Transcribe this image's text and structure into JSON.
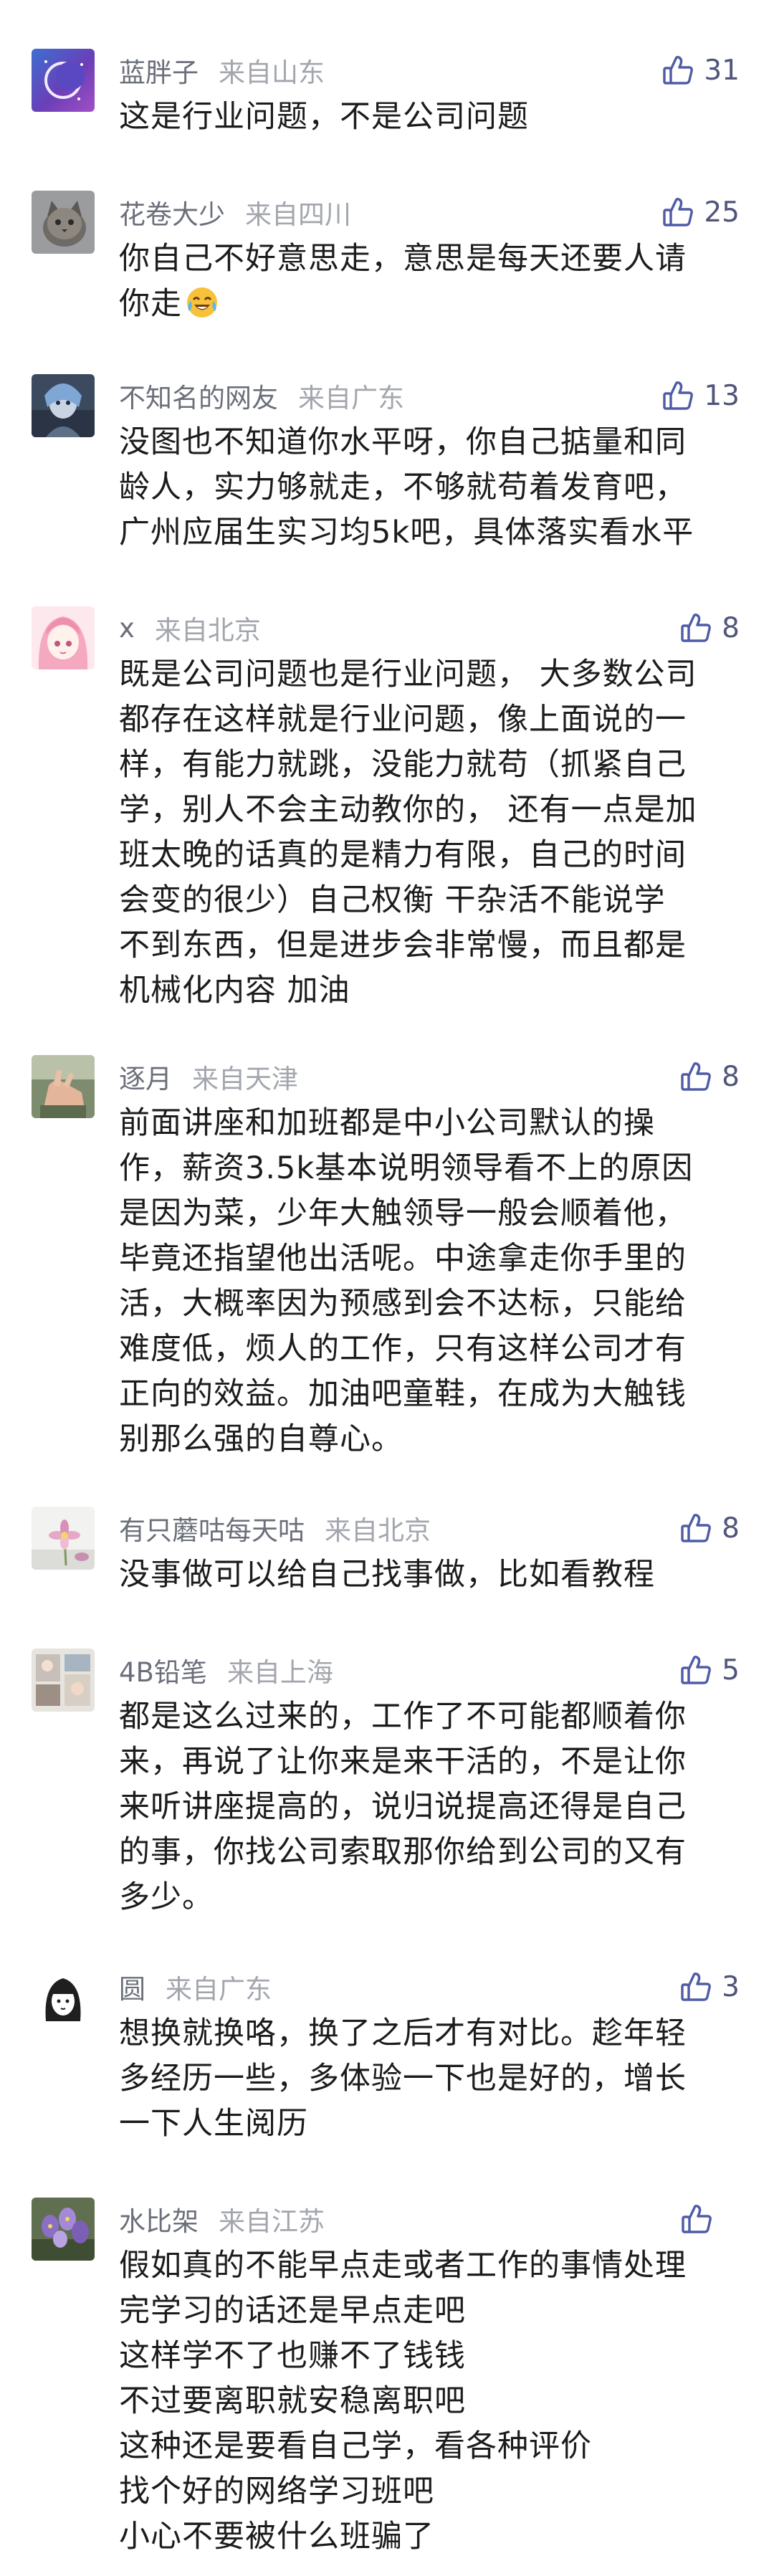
{
  "colors": {
    "username": "#6b6f7a",
    "location": "#a3a6ad",
    "like_icon": "#4e5ba6",
    "text": "#1c1c1e"
  },
  "comments": [
    {
      "username": "蓝胖子",
      "location": "来自山东",
      "likes": "31",
      "avatar_icon": "night-moon-avatar",
      "lines": [
        "这是行业问题，不是公司问题"
      ]
    },
    {
      "username": "花卷大少",
      "location": "来自四川",
      "likes": "25",
      "avatar_icon": "cat-avatar",
      "lines": [
        "你自己不好意思走，意思是每天还要人请",
        "你走"
      ],
      "emoji": "laughing-crying-emoji"
    },
    {
      "username": "不知名的网友",
      "location": "来自广东",
      "likes": "13",
      "avatar_icon": "game-character-avatar",
      "lines": [
        "没图也不知道你水平呀，你自己掂量和同",
        "龄人，实力够就走，不够就苟着发育吧，",
        "广州应届生实习均5k吧，具体落实看水平"
      ]
    },
    {
      "username": "x",
      "location": "来自北京",
      "likes": "8",
      "avatar_icon": "anime-girl-avatar",
      "lines": [
        "既是公司问题也是行业问题，  大多数公司",
        "都存在这样就是行业问题，像上面说的一",
        "样，有能力就跳，没能力就苟（抓紧自己",
        "学，别人不会主动教你的，  还有一点是加",
        "班太晚的话真的是精力有限，自己的时间",
        "会变的很少）自己权衡   干杂活不能说学",
        "不到东西，但是进步会非常慢，而且都是",
        "机械化内容  加油"
      ]
    },
    {
      "username": "逐月",
      "location": "来自天津",
      "likes": "8",
      "avatar_icon": "hand-photo-avatar",
      "lines": [
        "前面讲座和加班都是中小公司默认的操",
        "作，薪资3.5k基本说明领导看不上的原因",
        "是因为菜，少年大触领导一般会顺着他，",
        "毕竟还指望他出活呢。中途拿走你手里的",
        "活，大概率因为预感到会不达标，只能给",
        "难度低，烦人的工作，只有这样公司才有",
        "正向的效益。加油吧童鞋，在成为大触钱",
        "别那么强的自尊心。"
      ]
    },
    {
      "username": "有只蘑咕每天咕",
      "location": "来自北京",
      "likes": "8",
      "avatar_icon": "flower-avatar",
      "lines": [
        "没事做可以给自己找事做，比如看教程"
      ]
    },
    {
      "username": "4B铅笔",
      "location": "来自上海",
      "likes": "5",
      "avatar_icon": "photo-collage-avatar",
      "lines": [
        "都是这么过来的，工作了不可能都顺着你",
        "来，再说了让你来是来干活的，不是让你",
        "来听讲座提高的，说归说提高还得是自己",
        "的事，你找公司索取那你给到公司的又有",
        "多少。"
      ]
    },
    {
      "username": "圆",
      "location": "来自广东",
      "likes": "3",
      "avatar_icon": "cartoon-girl-avatar",
      "lines": [
        "想换就换咯，换了之后才有对比。趁年轻",
        "多经历一些，多体验一下也是好的，增长",
        "一下人生阅历"
      ]
    },
    {
      "username": "水比架",
      "location": "来自江苏",
      "likes": "",
      "avatar_icon": "purple-flowers-avatar",
      "lines": [
        "假如真的不能早点走或者工作的事情处理",
        "完学习的话还是早点走吧",
        "这样学不了也赚不了钱钱",
        "不过要离职就安稳离职吧",
        "这种还是要看自己学，看各种评价",
        "找个好的网络学习班吧",
        "小心不要被什么班骗了"
      ]
    }
  ]
}
